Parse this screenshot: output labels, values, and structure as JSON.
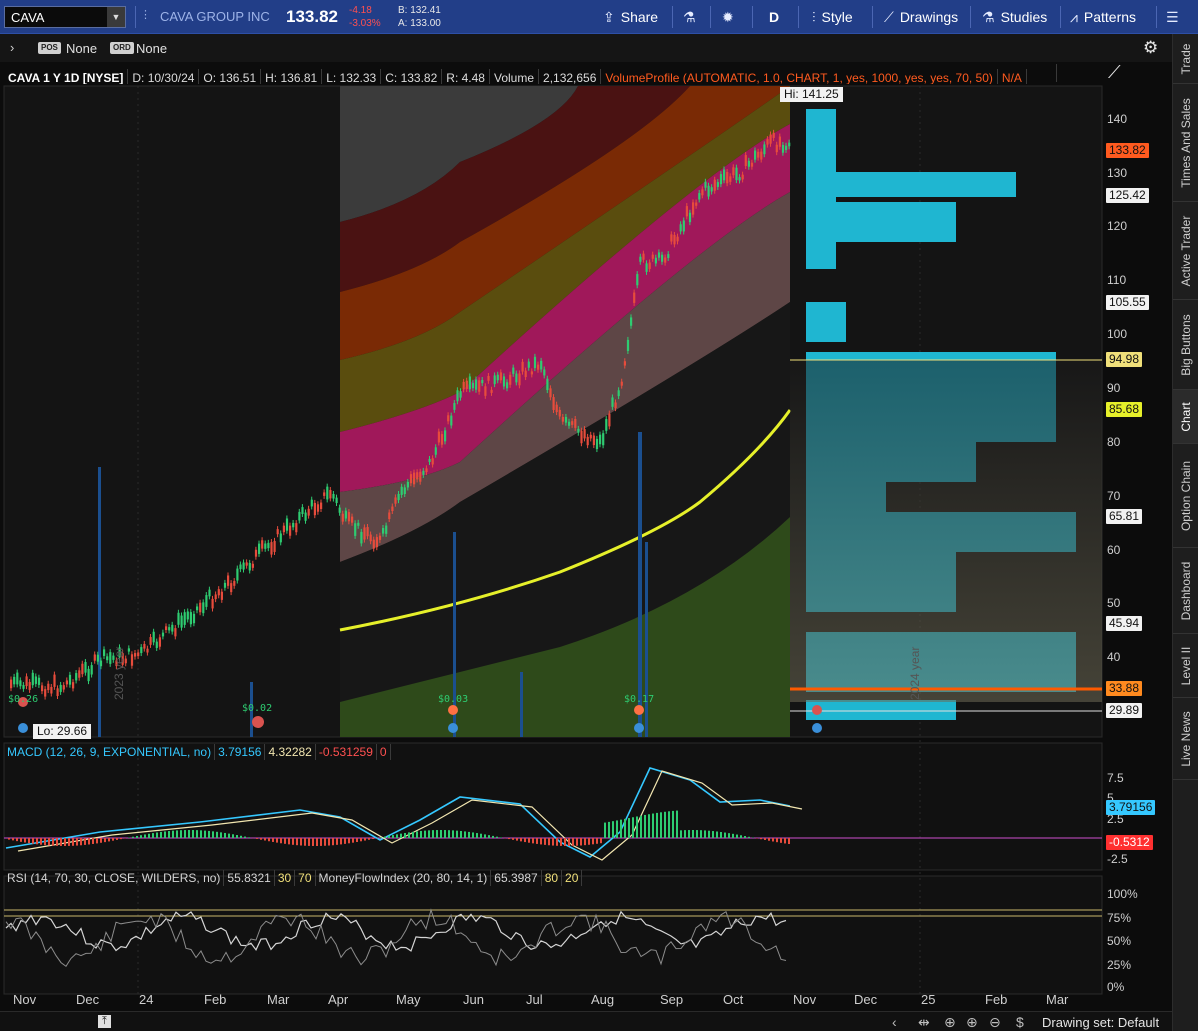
{
  "toolbar": {
    "symbol": "CAVA",
    "company": "CAVA GROUP INC",
    "last": "133.82",
    "change": "-4.18",
    "change_pct": "-3.03%",
    "bid": "B: 132.41",
    "ask": "A: 133.00",
    "share": "Share",
    "interval": "D",
    "style": "Style",
    "drawings": "Drawings",
    "studies": "Studies",
    "patterns": "Patterns"
  },
  "subbar": {
    "pos_tag": "POS",
    "pos_value": "None",
    "ord_tag": "ORD",
    "ord_value": "None"
  },
  "info": {
    "title": "CAVA 1 Y 1D [NYSE]",
    "date": "D: 10/30/24",
    "open": "O: 136.51",
    "high": "H: 136.81",
    "low": "L: 132.33",
    "close": "C: 133.82",
    "range": "R: 4.48",
    "volume_label": "Volume",
    "volume": "2,132,656",
    "volume_profile": "VolumeProfile (AUTOMATIC, 1.0, CHART, 1, yes, 1000, yes, yes, 70, 50)",
    "na": "N/A"
  },
  "annotations": {
    "hi": "Hi: 141.25",
    "lo": "Lo: 29.66",
    "year_2023": "2023 year",
    "year_2024": "2024 year",
    "div1": "$0.02",
    "div2": "$0.03",
    "div3": "$0.17",
    "div0": "$0.26"
  },
  "price_axis": [
    "140",
    "130",
    "120",
    "110",
    "100",
    "90",
    "80",
    "70",
    "60",
    "50",
    "40"
  ],
  "price_tags": {
    "last": "133.82",
    "p125": "125.42",
    "p105": "105.55",
    "p94": "94.98",
    "p85": "85.68",
    "p65": "65.81",
    "p45": "45.94",
    "p33": "33.88",
    "p29": "29.89"
  },
  "macd": {
    "title": "MACD (12, 26, 9, EXPONENTIAL, no)",
    "value": "3.79156",
    "avg": "4.32282",
    "diff": "-0.531259",
    "zero": "0",
    "axis": [
      "7.5",
      "5",
      "2.5",
      "-2.5"
    ],
    "tag_value": "3.79156",
    "tag_diff": "-0.5312"
  },
  "rsi": {
    "title": "RSI (14, 70, 30, CLOSE, WILDERS, no)",
    "value": "55.8321",
    "ob": "30",
    "os": "70",
    "mfi_title": "MoneyFlowIndex (20, 80, 14, 1)",
    "mfi_value": "65.3987",
    "mfi_hi": "80",
    "mfi_lo": "20",
    "axis": [
      "100%",
      "75%",
      "50%",
      "25%",
      "0%"
    ]
  },
  "time_axis": [
    "Nov",
    "Dec",
    "24",
    "Feb",
    "Mar",
    "Apr",
    "May",
    "Jun",
    "Jul",
    "Aug",
    "Sep",
    "Oct",
    "Nov",
    "Dec",
    "25",
    "Feb",
    "Mar"
  ],
  "right_tabs": [
    "Trade",
    "Times And Sales",
    "Active Trader",
    "Big Buttons",
    "Chart",
    "Option Chain",
    "Dashboard",
    "Level II",
    "Live News"
  ],
  "bottom": {
    "drawing_set": "Drawing set: Default"
  },
  "colors": {
    "topbar": "#223e88",
    "up": "#2ecc71",
    "down": "#e74c3c",
    "volume": "#1b4f8f",
    "profile": "#1fb6d1",
    "sma": "#e6f02a",
    "macd": "#35c8ff",
    "rsi": "#d5d5d5",
    "mfi": "#ff6a1a"
  }
}
